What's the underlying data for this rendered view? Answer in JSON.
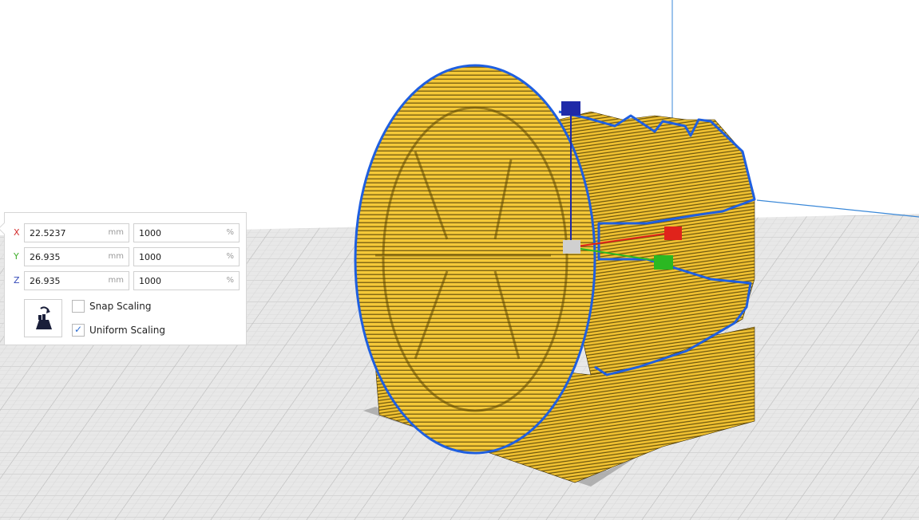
{
  "scale_tool": {
    "rows": [
      {
        "axis": "X",
        "axis_color": "#d42d2d",
        "size_mm": "22.5237",
        "size_unit": "mm",
        "percent": "1000",
        "percent_unit": "%"
      },
      {
        "axis": "Y",
        "axis_color": "#3fae2a",
        "size_mm": "26.935",
        "size_unit": "mm",
        "percent": "1000",
        "percent_unit": "%"
      },
      {
        "axis": "Z",
        "axis_color": "#3349b8",
        "size_mm": "26.935",
        "size_unit": "mm",
        "percent": "1000",
        "percent_unit": "%"
      }
    ],
    "lock_button_icon": "scale-to-max-icon",
    "snap_scaling": {
      "label": "Snap Scaling",
      "checked": false
    },
    "uniform_scaling": {
      "label": "Uniform Scaling",
      "checked": true,
      "check_glyph": "✓"
    }
  },
  "viewport": {
    "model_color": "#f2c230",
    "outline_color": "#1f5fe0",
    "gizmo": {
      "x_handle_color": "#e0231b",
      "y_handle_color": "#2bb822",
      "z_handle_color": "#1f2aa8"
    }
  }
}
